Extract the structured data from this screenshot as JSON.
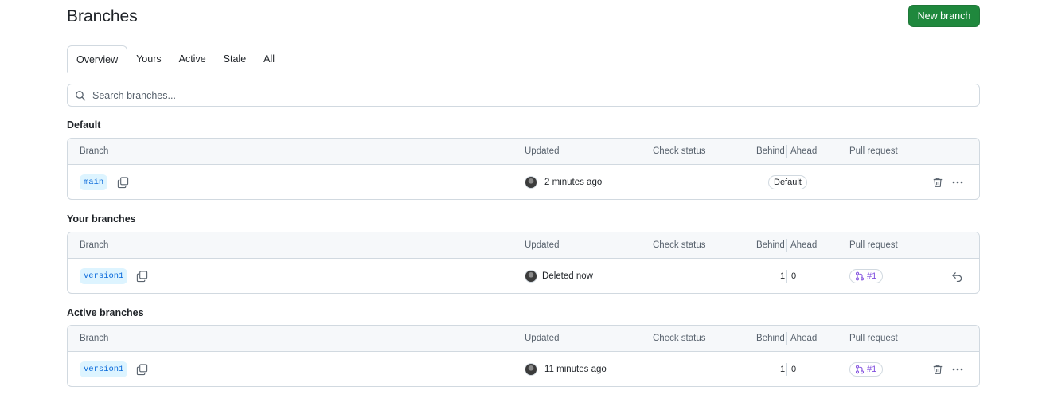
{
  "header": {
    "title": "Branches",
    "new_branch_label": "New branch"
  },
  "tabs": [
    {
      "label": "Overview",
      "selected": true
    },
    {
      "label": "Yours"
    },
    {
      "label": "Active"
    },
    {
      "label": "Stale"
    },
    {
      "label": "All"
    }
  ],
  "search": {
    "placeholder": "Search branches..."
  },
  "columns": {
    "branch": "Branch",
    "updated": "Updated",
    "check_status": "Check status",
    "behind": "Behind",
    "ahead": "Ahead",
    "pull_request": "Pull request"
  },
  "sections": [
    {
      "heading": "Default",
      "rows": [
        {
          "branch": "main",
          "updated": "2 minutes ago",
          "badge": "Default",
          "actions": [
            "trash-icon",
            "kebab-icon"
          ]
        }
      ]
    },
    {
      "heading": "Your branches",
      "rows": [
        {
          "branch": "version1",
          "updated": "Deleted now",
          "behind": "1",
          "ahead": "0",
          "pr": "#1",
          "actions": [
            "undo-icon"
          ]
        }
      ]
    },
    {
      "heading": "Active branches",
      "rows": [
        {
          "branch": "version1",
          "updated": "11 minutes ago",
          "behind": "1",
          "ahead": "0",
          "pr": "#1",
          "actions": [
            "trash-icon",
            "kebab-icon"
          ]
        }
      ]
    }
  ],
  "colors": {
    "primary_button": "#1f883d",
    "link": "#0969da",
    "pr_purple": "#8250df",
    "border": "#d1d9e0"
  }
}
